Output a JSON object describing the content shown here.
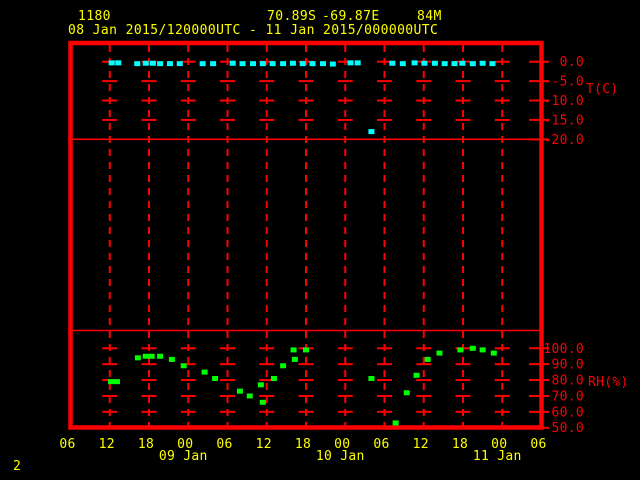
{
  "header": {
    "station_id": "1180",
    "latitude": "70.89S",
    "longitude": "-69.87E",
    "elevation": "84M",
    "period": "08 Jan 2015/120000UTC - 11 Jan 2015/000000UTC"
  },
  "footer": {
    "page_indicator": "2"
  },
  "colors": {
    "background": "#000000",
    "grid": "#ff0000",
    "header_text": "#ffff00",
    "temperature": "#00ffff",
    "humidity": "#00ff00"
  },
  "time_axis": {
    "hours_span": 72,
    "x_unit": "hours_from_first_tick",
    "tick_labels": [
      {
        "hour": 0,
        "label": "06"
      },
      {
        "hour": 6,
        "label": "12"
      },
      {
        "hour": 12,
        "label": "18"
      },
      {
        "hour": 18,
        "label": "00"
      },
      {
        "hour": 24,
        "label": "06"
      },
      {
        "hour": 30,
        "label": "12"
      },
      {
        "hour": 36,
        "label": "18"
      },
      {
        "hour": 42,
        "label": "00"
      },
      {
        "hour": 48,
        "label": "06"
      },
      {
        "hour": 54,
        "label": "12"
      },
      {
        "hour": 60,
        "label": "18"
      },
      {
        "hour": 66,
        "label": "00"
      },
      {
        "hour": 72,
        "label": "06"
      }
    ],
    "date_labels": [
      {
        "hour": 18,
        "label": "09 Jan"
      },
      {
        "hour": 42,
        "label": "10 Jan"
      },
      {
        "hour": 66,
        "label": "11 Jan"
      }
    ]
  },
  "chart_data": [
    {
      "type": "scatter",
      "name": "temperature",
      "ylabel": "T(C)",
      "yticks": [
        0,
        -5,
        -10,
        -15,
        -20
      ],
      "ytick_labels": [
        "0.0",
        "-5.0",
        "-10.0",
        "-15.0",
        "-20.0"
      ],
      "ylim": [
        -20,
        5
      ],
      "grid": true,
      "marker_color": "#00ffff",
      "points": [
        [
          6.3,
          -0.3
        ],
        [
          7.3,
          -0.3
        ],
        [
          10.2,
          -0.5
        ],
        [
          11.5,
          -0.4
        ],
        [
          12.6,
          -0.4
        ],
        [
          13.7,
          -0.5
        ],
        [
          15.2,
          -0.5
        ],
        [
          16.7,
          -0.5
        ],
        [
          20.2,
          -0.5
        ],
        [
          21.8,
          -0.5
        ],
        [
          24.8,
          -0.4
        ],
        [
          26.3,
          -0.5
        ],
        [
          27.9,
          -0.5
        ],
        [
          29.4,
          -0.5
        ],
        [
          30.9,
          -0.5
        ],
        [
          32.5,
          -0.5
        ],
        [
          34.0,
          -0.4
        ],
        [
          35.5,
          -0.5
        ],
        [
          37.0,
          -0.5
        ],
        [
          38.6,
          -0.5
        ],
        [
          40.1,
          -0.6
        ],
        [
          42.8,
          -0.3
        ],
        [
          43.9,
          -0.3
        ],
        [
          46.0,
          -18.0
        ],
        [
          49.2,
          -0.4
        ],
        [
          50.8,
          -0.5
        ],
        [
          52.6,
          -0.3
        ],
        [
          54.1,
          -0.4
        ],
        [
          55.7,
          -0.4
        ],
        [
          57.2,
          -0.5
        ],
        [
          58.7,
          -0.5
        ],
        [
          59.9,
          -0.4
        ],
        [
          61.5,
          -0.5
        ],
        [
          63.0,
          -0.4
        ],
        [
          64.5,
          -0.5
        ]
      ]
    },
    {
      "type": "scatter",
      "name": "relative_humidity",
      "ylabel": "RH(%)",
      "yticks": [
        100,
        90,
        80,
        70,
        60,
        50
      ],
      "ytick_labels": [
        "100.0",
        "90.0",
        "80.0",
        "70.0",
        "60.0",
        "50.0"
      ],
      "ylim": [
        50,
        100
      ],
      "grid": true,
      "marker_color": "#00ff00",
      "points": [
        [
          6.2,
          79
        ],
        [
          7.1,
          79
        ],
        [
          10.3,
          94
        ],
        [
          11.5,
          95
        ],
        [
          12.4,
          95
        ],
        [
          13.7,
          95
        ],
        [
          15.5,
          93
        ],
        [
          17.3,
          89
        ],
        [
          20.5,
          85
        ],
        [
          22.1,
          81
        ],
        [
          25.9,
          73
        ],
        [
          27.4,
          70
        ],
        [
          29.1,
          77
        ],
        [
          29.4,
          66
        ],
        [
          31.1,
          81
        ],
        [
          32.5,
          89
        ],
        [
          34.1,
          99
        ],
        [
          34.3,
          93
        ],
        [
          36.0,
          99
        ],
        [
          46.0,
          81
        ],
        [
          49.7,
          53
        ],
        [
          51.4,
          72
        ],
        [
          52.9,
          83
        ],
        [
          54.6,
          93
        ],
        [
          56.4,
          97
        ],
        [
          59.6,
          99
        ],
        [
          61.5,
          100
        ],
        [
          63.0,
          99
        ],
        [
          64.7,
          97
        ]
      ]
    }
  ]
}
